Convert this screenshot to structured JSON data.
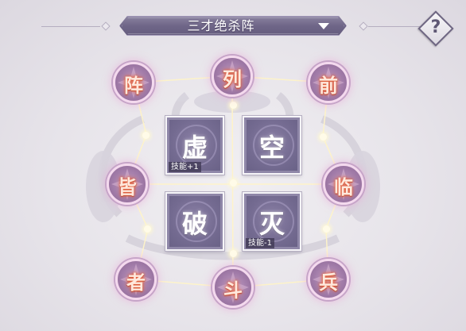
{
  "formation": {
    "selected": "三才绝杀阵"
  },
  "help": {
    "label": "?"
  },
  "center_cells": [
    {
      "char": "虚",
      "tag": "技能+1"
    },
    {
      "char": "空",
      "tag": ""
    },
    {
      "char": "破",
      "tag": ""
    },
    {
      "char": "灭",
      "tag": "技能-1"
    }
  ],
  "outer_nodes": {
    "top_left": "阵",
    "top_center": "列",
    "top_right": "前",
    "mid_left": "皆",
    "mid_right": "临",
    "bottom_left": "者",
    "bottom_center": "斗",
    "bottom_right": "兵"
  },
  "colors": {
    "title_bar": "#6f6688",
    "cell_bg": "#746b91",
    "node_glow": "#e6603a",
    "link_line": "#fff4c8"
  }
}
